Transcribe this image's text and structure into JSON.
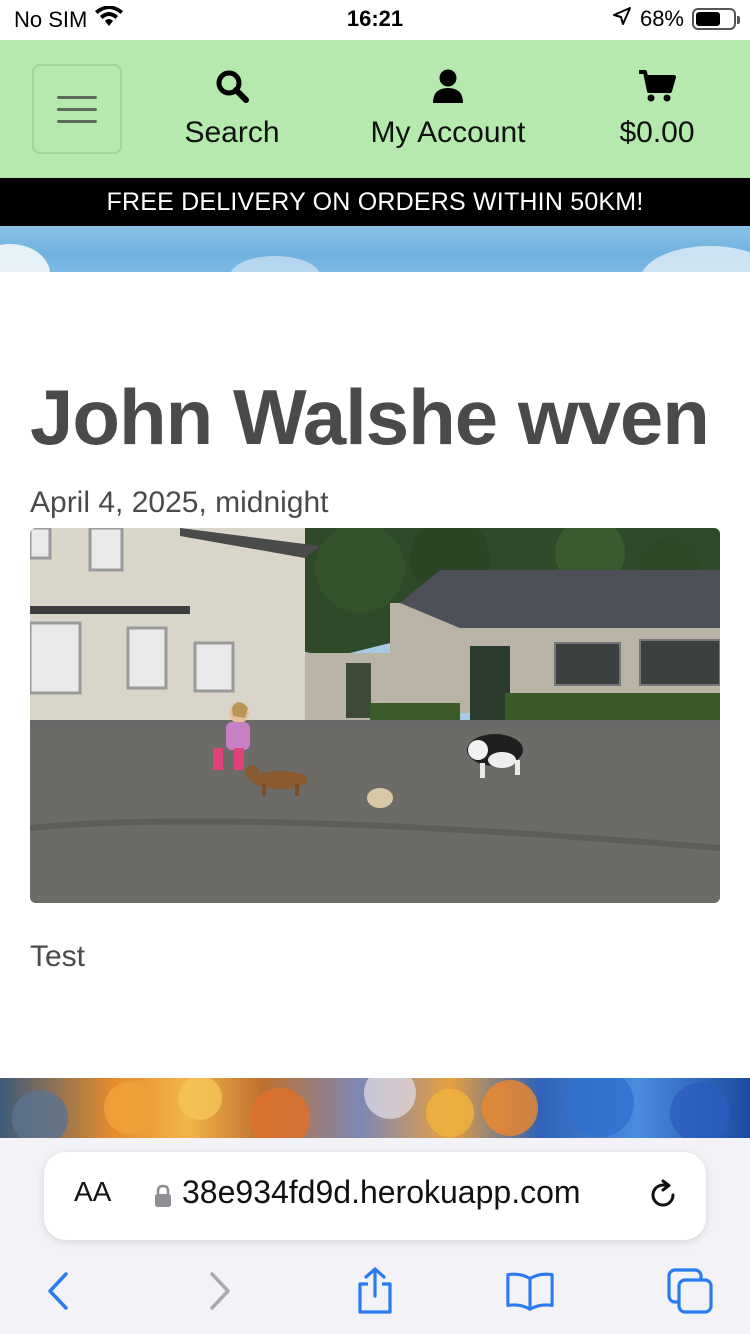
{
  "status": {
    "carrier": "No SIM",
    "time": "16:21",
    "battery": "68%",
    "battery_level": 0.68
  },
  "navbar": {
    "search_label": "Search",
    "account_label": "My Account",
    "cart_label": "$0.00"
  },
  "banner": {
    "text": "FREE DELIVERY ON ORDERS WITHIN 50KM!"
  },
  "post": {
    "title": "John Walshe wven",
    "date": "April 4, 2025, midnight",
    "body": "Test"
  },
  "browser": {
    "aa_label": "AA",
    "url": "38e934fd9d.herokuapp.com"
  },
  "colors": {
    "navbar_bg": "#b5e9ad",
    "banner_bg": "#000000",
    "link_blue": "#2b7bf0"
  },
  "icons": {
    "menu": "hamburger-icon",
    "search": "search-icon",
    "account": "user-icon",
    "cart": "cart-icon",
    "back": "chevron-left-icon",
    "forward": "chevron-right-icon",
    "share": "share-icon",
    "bookmarks": "book-icon",
    "tabs": "tabs-icon"
  }
}
